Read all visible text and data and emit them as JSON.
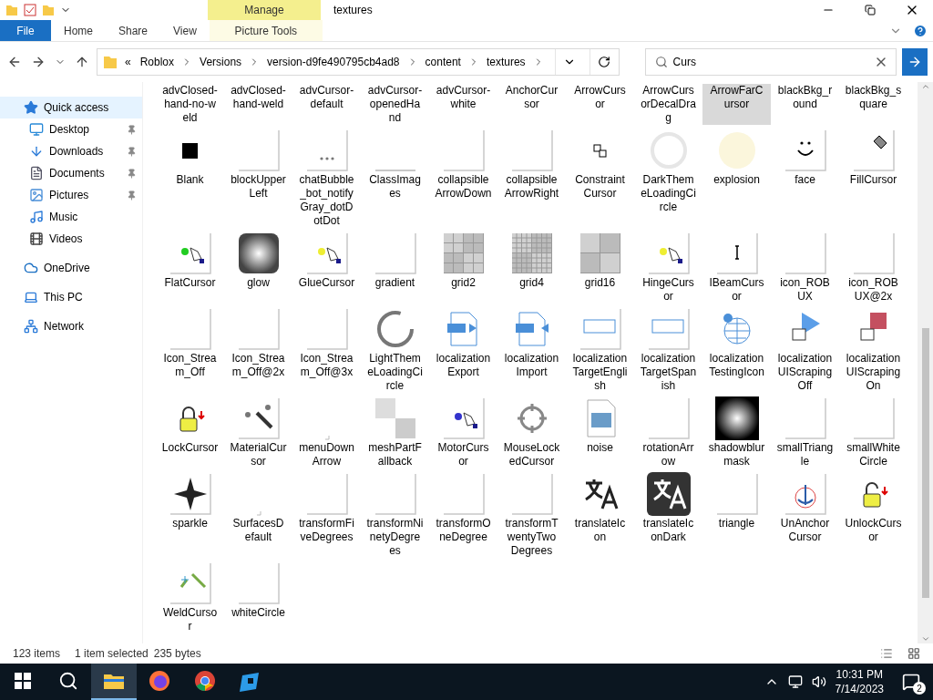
{
  "window": {
    "title": "textures"
  },
  "ribbon": {
    "context_group": "Manage",
    "tabs": [
      {
        "label": "File",
        "kind": "file",
        "selected": false
      },
      {
        "label": "Home",
        "kind": "plain",
        "selected": false
      },
      {
        "label": "Share",
        "kind": "plain",
        "selected": false
      },
      {
        "label": "View",
        "kind": "plain",
        "selected": false
      },
      {
        "label": "Picture Tools",
        "kind": "context",
        "selected": false
      }
    ]
  },
  "address": {
    "overflow": "«",
    "crumbs": [
      "Roblox",
      "Versions",
      "version-d9fe490795cb4ad8",
      "content",
      "textures"
    ]
  },
  "search": {
    "value": "Curs"
  },
  "sidebar": {
    "items": [
      {
        "label": "Quick access",
        "kind": "star",
        "selected": true,
        "children": [
          {
            "label": "Desktop",
            "kind": "desktop",
            "pinned": true
          },
          {
            "label": "Downloads",
            "kind": "download",
            "pinned": true
          },
          {
            "label": "Documents",
            "kind": "document",
            "pinned": true
          },
          {
            "label": "Pictures",
            "kind": "pictures",
            "pinned": true
          },
          {
            "label": "Music",
            "kind": "music",
            "pinned": false
          },
          {
            "label": "Videos",
            "kind": "video",
            "pinned": false
          }
        ]
      },
      {
        "label": "OneDrive",
        "kind": "cloud",
        "selected": false
      },
      {
        "label": "This PC",
        "kind": "pc",
        "selected": false
      },
      {
        "label": "Network",
        "kind": "network",
        "selected": false
      }
    ]
  },
  "files": [
    {
      "name": "advClosed-hand-no-weld",
      "selected": false
    },
    {
      "name": "advClosed-hand-weld",
      "selected": false
    },
    {
      "name": "advCursor-default",
      "selected": false
    },
    {
      "name": "advCursor-openedHand",
      "selected": false
    },
    {
      "name": "advCursor-white",
      "selected": false
    },
    {
      "name": "AnchorCursor",
      "selected": false
    },
    {
      "name": "ArrowCursor",
      "selected": false
    },
    {
      "name": "ArrowCursorDecalDrag",
      "selected": false
    },
    {
      "name": "ArrowFarCursor",
      "selected": true
    },
    {
      "name": "blackBkg_round",
      "selected": false
    },
    {
      "name": "blackBkg_square",
      "selected": false
    },
    {
      "name": "Blank",
      "kind": "black",
      "selected": false
    },
    {
      "name": "blockUpperLeft",
      "kind": "paper",
      "selected": false
    },
    {
      "name": "chatBubble_bot_notifyGray_dotDotDot",
      "kind": "dots",
      "selected": false
    },
    {
      "name": "ClassImages",
      "kind": "strip",
      "selected": false
    },
    {
      "name": "collapsibleArrowDown",
      "kind": "paper",
      "selected": false
    },
    {
      "name": "collapsibleArrowRight",
      "kind": "paper",
      "selected": false
    },
    {
      "name": "ConstraintCursor",
      "kind": "constraint",
      "selected": false
    },
    {
      "name": "DarkThemeLoadingCircle",
      "kind": "ring-light",
      "selected": false
    },
    {
      "name": "explosion",
      "kind": "burst",
      "selected": false
    },
    {
      "name": "face",
      "kind": "smiley",
      "selected": false
    },
    {
      "name": "FillCursor",
      "kind": "fill",
      "selected": false
    },
    {
      "name": "FlatCursor",
      "kind": "hand-green",
      "selected": false
    },
    {
      "name": "glow",
      "kind": "glow",
      "selected": false
    },
    {
      "name": "GlueCursor",
      "kind": "hand-yellow",
      "selected": false
    },
    {
      "name": "gradient",
      "kind": "paper",
      "selected": false
    },
    {
      "name": "grid2",
      "kind": "grid-medium",
      "selected": false
    },
    {
      "name": "grid4",
      "kind": "grid-fine",
      "selected": false
    },
    {
      "name": "grid16",
      "kind": "grid-coarse",
      "selected": false
    },
    {
      "name": "HingeCursor",
      "kind": "hand-yellow",
      "selected": false
    },
    {
      "name": "IBeamCursor",
      "kind": "ibeam",
      "selected": false
    },
    {
      "name": "icon_ROBUX",
      "kind": "paper",
      "selected": false
    },
    {
      "name": "icon_ROBUX@2x",
      "kind": "paper",
      "selected": false
    },
    {
      "name": "Icon_Stream_Off",
      "kind": "paper",
      "selected": false
    },
    {
      "name": "Icon_Stream_Off@2x",
      "kind": "paper",
      "selected": false
    },
    {
      "name": "Icon_Stream_Off@3x",
      "kind": "paper",
      "selected": false
    },
    {
      "name": "LightThemeLoadingCircle",
      "kind": "ring-dark",
      "selected": false
    },
    {
      "name": "localizationExport",
      "kind": "doc-out",
      "selected": false
    },
    {
      "name": "localizationImport",
      "kind": "doc-in",
      "selected": false
    },
    {
      "name": "localizationTargetEnglish",
      "kind": "tag",
      "selected": false
    },
    {
      "name": "localizationTargetSpanish",
      "kind": "tag",
      "selected": false
    },
    {
      "name": "localizationTestingIcon",
      "kind": "globe",
      "selected": false
    },
    {
      "name": "localizationUIScrapingOff",
      "kind": "scrape-off",
      "selected": false
    },
    {
      "name": "localizationUIScrapingOn",
      "kind": "scrape-on",
      "selected": false
    },
    {
      "name": "LockCursor",
      "kind": "lock",
      "selected": false
    },
    {
      "name": "MaterialCursor",
      "kind": "material",
      "selected": false
    },
    {
      "name": "menuDownArrow",
      "kind": "tiny",
      "selected": false
    },
    {
      "name": "meshPartFallback",
      "kind": "checker",
      "selected": false
    },
    {
      "name": "MotorCursor",
      "kind": "hand-blue",
      "selected": false
    },
    {
      "name": "MouseLockedCursor",
      "kind": "crosshair",
      "selected": false
    },
    {
      "name": "noise",
      "kind": "picture",
      "selected": false
    },
    {
      "name": "rotationArrow",
      "kind": "paper",
      "selected": false
    },
    {
      "name": "shadowblurmask",
      "kind": "radial",
      "selected": false
    },
    {
      "name": "smallTriangle",
      "kind": "paper",
      "selected": false
    },
    {
      "name": "smallWhiteCircle",
      "kind": "paper",
      "selected": false
    },
    {
      "name": "sparkle",
      "kind": "sparkle",
      "selected": false
    },
    {
      "name": "SurfacesDefault",
      "kind": "tiny",
      "selected": false
    },
    {
      "name": "transformFiveDegrees",
      "kind": "paper",
      "selected": false
    },
    {
      "name": "transformNinetyDegrees",
      "kind": "paper",
      "selected": false
    },
    {
      "name": "transformOneDegree",
      "kind": "paper",
      "selected": false
    },
    {
      "name": "transformTwentyTwoDegrees",
      "kind": "paper",
      "selected": false
    },
    {
      "name": "translateIcon",
      "kind": "translate",
      "selected": false
    },
    {
      "name": "translateIconDark",
      "kind": "translate-dark",
      "selected": false
    },
    {
      "name": "triangle",
      "kind": "paper",
      "selected": false
    },
    {
      "name": "UnAnchorCursor",
      "kind": "anchor",
      "selected": false
    },
    {
      "name": "UnlockCursor",
      "kind": "unlock",
      "selected": false
    },
    {
      "name": "WeldCursor",
      "kind": "weld",
      "selected": false
    },
    {
      "name": "whiteCircle",
      "kind": "paper",
      "selected": false
    }
  ],
  "status_bar": {
    "count": "123 items",
    "selection": "1 item selected",
    "size": "235 bytes"
  },
  "taskbar": {
    "apps": [
      {
        "kind": "explorer",
        "active": true
      },
      {
        "kind": "firefox",
        "active": false
      },
      {
        "kind": "chrome",
        "active": false
      },
      {
        "kind": "studio",
        "active": false
      }
    ],
    "time": "10:31 PM",
    "date": "7/14/2023",
    "notifications": "2"
  }
}
